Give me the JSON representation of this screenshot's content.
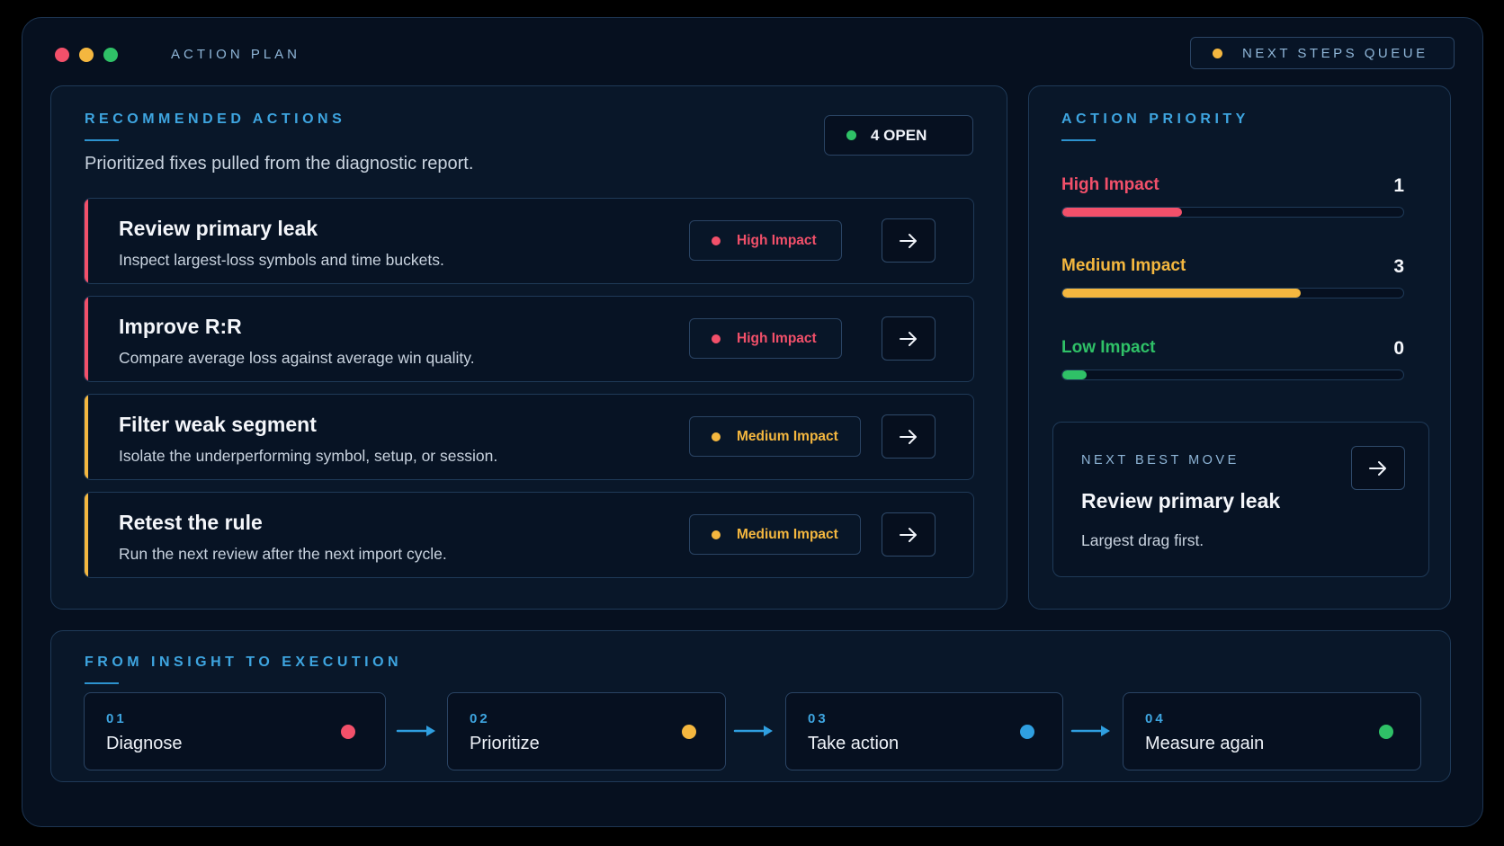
{
  "window": {
    "title": "ACTION PLAN",
    "traffic_lights": [
      {
        "name": "close",
        "color": "#f2506a"
      },
      {
        "name": "minimize",
        "color": "#f4b73f"
      },
      {
        "name": "maximize",
        "color": "#2fc167"
      }
    ],
    "queue_button": {
      "label": "NEXT STEPS QUEUE",
      "dot_color": "#f4b73f"
    }
  },
  "recommended": {
    "title": "RECOMMENDED ACTIONS",
    "subtitle": "Prioritized fixes pulled from the diagnostic report.",
    "open_badge": {
      "label": "4 OPEN",
      "dot_color": "#2fc167"
    },
    "actions": [
      {
        "title": "Review primary leak",
        "description": "Inspect largest-loss symbols and time buckets.",
        "impact": "High Impact",
        "color": "#f2506a",
        "arrow_icon": "arrow-right-icon"
      },
      {
        "title": "Improve R:R",
        "description": "Compare average loss against average win quality.",
        "impact": "High Impact",
        "color": "#f2506a",
        "arrow_icon": "arrow-right-icon"
      },
      {
        "title": "Filter weak segment",
        "description": "Isolate the underperforming symbol, setup, or session.",
        "impact": "Medium Impact",
        "color": "#f4b73f",
        "arrow_icon": "arrow-right-icon"
      },
      {
        "title": "Retest the rule",
        "description": "Run the next review after the next import cycle.",
        "impact": "Medium Impact",
        "color": "#f4b73f",
        "arrow_icon": "arrow-right-icon"
      }
    ]
  },
  "priority": {
    "title": "ACTION PRIORITY",
    "rows": [
      {
        "label": "High Impact",
        "count": "1",
        "fraction": 0.35,
        "color": "#f2506a"
      },
      {
        "label": "Medium Impact",
        "count": "3",
        "fraction": 0.7,
        "color": "#f4b73f"
      },
      {
        "label": "Low Impact",
        "count": "0",
        "fraction": 0.07,
        "color": "#2fc167"
      }
    ],
    "next_best_move": {
      "kicker": "NEXT BEST MOVE",
      "title": "Review primary leak",
      "description": "Largest drag first.",
      "arrow_icon": "arrow-right-icon"
    }
  },
  "execution": {
    "title": "FROM INSIGHT TO EXECUTION",
    "steps": [
      {
        "number": "01",
        "label": "Diagnose",
        "color": "#f2506a"
      },
      {
        "number": "02",
        "label": "Prioritize",
        "color": "#f4b73f"
      },
      {
        "number": "03",
        "label": "Take action",
        "color": "#2f9fe0"
      },
      {
        "number": "04",
        "label": "Measure again",
        "color": "#2fc167"
      }
    ],
    "connector_color": "#2f9fe0"
  }
}
